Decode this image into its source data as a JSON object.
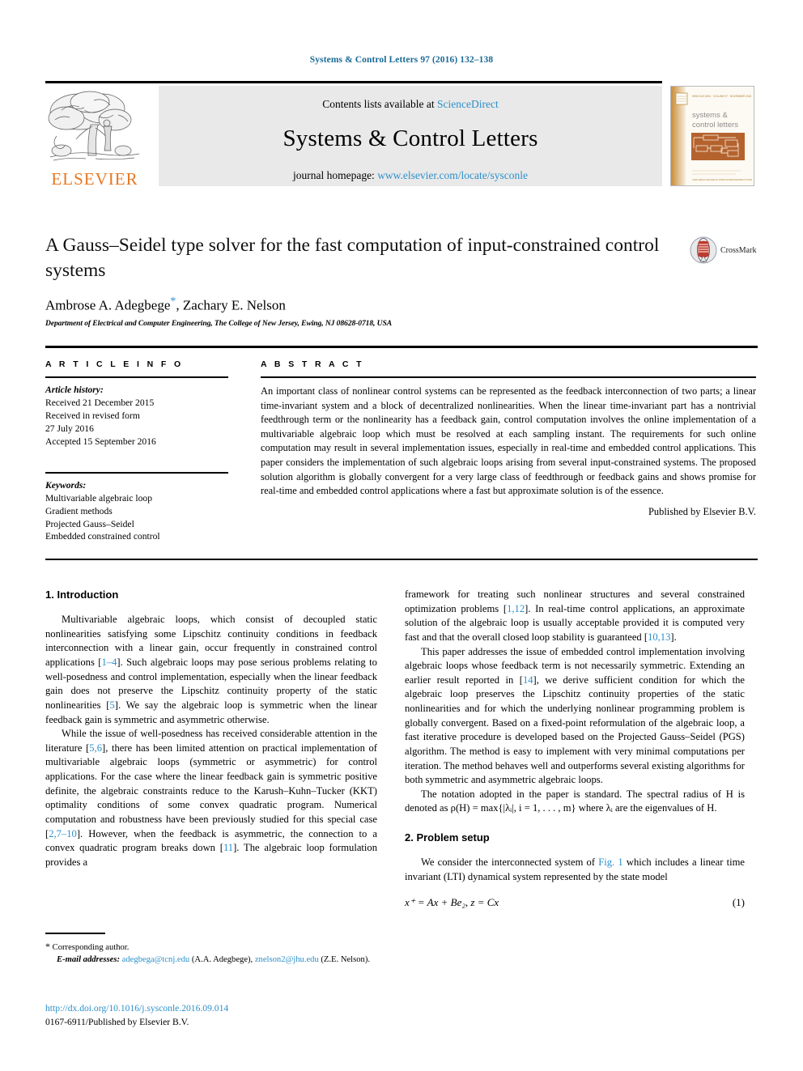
{
  "running_head": "Systems & Control Letters 97 (2016) 132–138",
  "masthead": {
    "contents_prefix": "Contents lists available at ",
    "sciencedirect": "ScienceDirect",
    "journal_title": "Systems & Control Letters",
    "homepage_prefix": "journal homepage: ",
    "homepage_url": "www.elsevier.com/locate/sysconle",
    "publisher_name": "ELSEVIER",
    "cover_title_line1": "systems &",
    "cover_title_line2": "control letters",
    "link_color": "#2c8fc9",
    "elsevier_orange": "#e87722"
  },
  "article": {
    "title": "A Gauss–Seidel type solver for the fast computation of input-constrained control systems",
    "authors": "Ambrose A. Adegbege",
    "authors_rest": ", Zachary E. Nelson",
    "corresponding_marker": "*",
    "affiliation": "Department of Electrical and Computer Engineering, The College of New Jersey, Ewing, NJ 08628-0718, USA",
    "crossmark_label": "CrossMark"
  },
  "info": {
    "heading": "A R T I C L E   I N F O",
    "history_label": "Article history:",
    "history_lines": [
      "Received 21 December 2015",
      "Received in revised form",
      "27 July 2016",
      "Accepted 15 September 2016"
    ],
    "keywords_label": "Keywords:",
    "keywords": [
      "Multivariable algebraic loop",
      "Gradient methods",
      "Projected Gauss–Seidel",
      "Embedded constrained control"
    ]
  },
  "abstract": {
    "heading": "A B S T R A C T",
    "text": "An important class of nonlinear control systems can be represented as the feedback interconnection of two parts; a linear time-invariant system and a block of decentralized nonlinearities. When the linear time-invariant part has a nontrivial feedthrough term or the nonlinearity has a feedback gain, control computation involves the online implementation of a multivariable algebraic loop which must be resolved at each sampling instant. The requirements for such online computation may result in several implementation issues, especially in real-time and embedded control applications. This paper considers the implementation of such algebraic loops arising from several input-constrained systems. The proposed solution algorithm is globally convergent for a very large class of feedthrough or feedback gains and shows promise for real-time and embedded control applications where a fast but approximate solution is of the essence.",
    "published_by": "Published by Elsevier B.V."
  },
  "sections": {
    "intro_heading": "1. Introduction",
    "intro_p1_a": "Multivariable algebraic loops, which consist of decoupled static nonlinearities satisfying some Lipschitz continuity conditions in feedback interconnection with a linear gain, occur frequently in constrained control applications [",
    "intro_p1_ref1": "1–4",
    "intro_p1_b": "]. Such algebraic loops may pose serious problems relating to well-posedness and control implementation, especially when the linear feedback gain does not preserve the Lipschitz continuity property of the static nonlinearities [",
    "intro_p1_ref2": "5",
    "intro_p1_c": "]. We say the algebraic loop is symmetric when the linear feedback gain is symmetric and asymmetric otherwise.",
    "intro_p2_a": "While the issue of well-posedness has received considerable attention in the literature [",
    "intro_p2_ref1": "5,6",
    "intro_p2_b": "], there has been limited attention on practical implementation of multivariable algebraic loops (symmetric or asymmetric) for control applications. For the case where the linear feedback gain is symmetric positive definite, the algebraic constraints reduce to the Karush–Kuhn–Tucker (KKT) optimality conditions of some convex quadratic program. Numerical computation and robustness have been previously studied for this special case [",
    "intro_p2_ref2": "2,7–10",
    "intro_p2_c": "]. However, when the feedback is asymmetric, the connection to a convex quadratic program breaks down [",
    "intro_p2_ref3": "11",
    "intro_p2_d": "]. The algebraic loop formulation provides a",
    "right_p1_a": "framework for treating such nonlinear structures and several constrained optimization problems [",
    "right_p1_ref1": "1,12",
    "right_p1_b": "]. In real-time control applications, an approximate solution of the algebraic loop is usually acceptable provided it is computed very fast and that the overall closed loop stability is guaranteed [",
    "right_p1_ref2": "10,13",
    "right_p1_c": "].",
    "right_p2_a": "This paper addresses the issue of embedded control implementation involving algebraic loops whose feedback term is not necessarily symmetric. Extending an earlier result reported in [",
    "right_p2_ref1": "14",
    "right_p2_b": "], we derive sufficient condition for which the algebraic loop preserves the Lipschitz continuity properties of the static nonlinearities and for which the underlying nonlinear programming problem is globally convergent. Based on a fixed-point reformulation of the algebraic loop, a fast iterative procedure is developed based on the Projected Gauss–Seidel (PGS) algorithm. The method is easy to implement with very minimal computations per iteration. The method behaves well and outperforms several existing algorithms for both symmetric and asymmetric algebraic loops.",
    "right_p3": "The notation adopted in the paper is standard. The spectral radius of H is denoted as ρ(H) = max{|λᵢ|, i = 1, . . . , m} where λᵢ are the eigenvalues of H.",
    "problem_heading": "2. Problem setup",
    "problem_p1_a": "We consider the interconnected system of ",
    "problem_p1_figref": "Fig. 1",
    "problem_p1_b": " which includes a linear time invariant (LTI) dynamical system represented by the state model",
    "equation_1": "x⁺ = Ax + Be₂,        z = Cx",
    "equation_1_number": "(1)"
  },
  "footnote": {
    "star": "*",
    "corresponding": " Corresponding author.",
    "email_label": "E-mail addresses:",
    "email1": "adegbega@tcnj.edu",
    "email1_attr": " (A.A. Adegbege), ",
    "email2": "znelson2@jhu.edu",
    "email2_attr": " (Z.E. Nelson).",
    "doi": "http://dx.doi.org/10.1016/j.sysconle.2016.09.014",
    "issn_line": "0167-6911/Published by Elsevier B.V."
  }
}
